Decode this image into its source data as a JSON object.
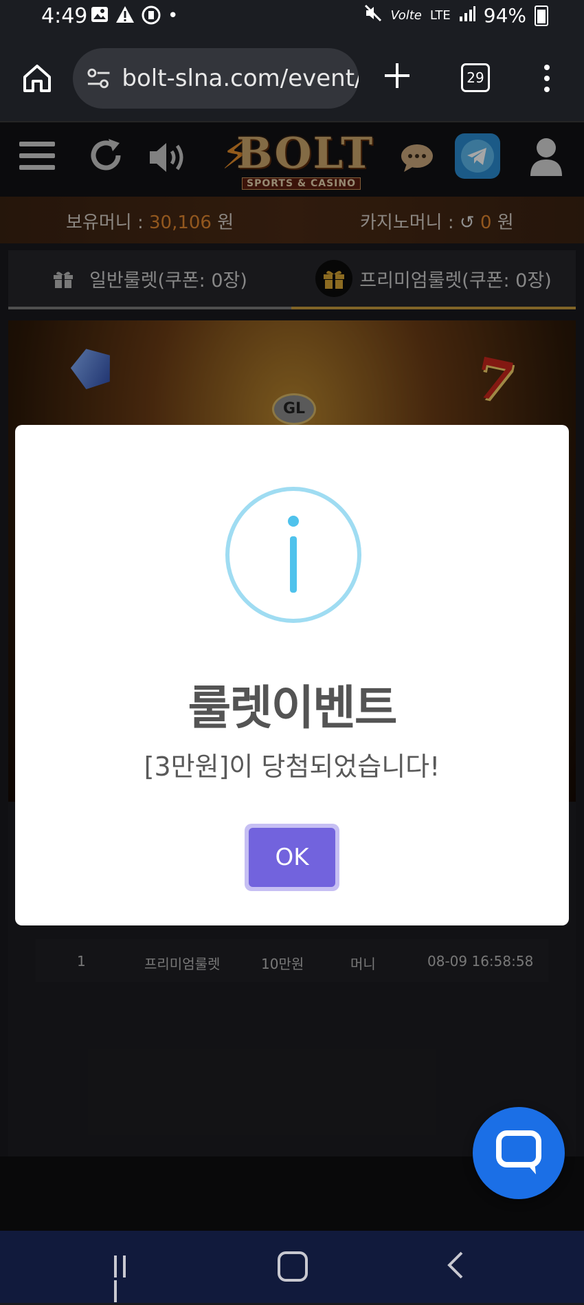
{
  "status_bar": {
    "time": "4:49",
    "lte": "LTE",
    "battery": "94%"
  },
  "browser": {
    "url": "bolt-slna.com/event/",
    "tab_count": "29"
  },
  "site": {
    "logo_text": "BOLT",
    "logo_sub": "SPORTS & CASINO"
  },
  "money": {
    "holding_label": "보유머니 : ",
    "holding_value": "30,106",
    "holding_unit": " 원",
    "casino_label": "카지노머니 : ",
    "casino_value": "0",
    "casino_unit": " 원"
  },
  "tabs": {
    "normal": "일반룰렛(쿠폰: 0장)",
    "premium": "프리미엄룰렛(쿠폰: 0장)"
  },
  "roulette": {
    "badge": "GL"
  },
  "win_table": {
    "rows": [
      {
        "no": "1",
        "type": "프리미엄룰렛",
        "amount": "10만원",
        "kind": "머니",
        "time": "08-09 16:58:58"
      }
    ]
  },
  "modal": {
    "title": "룰렛이벤트",
    "message": "[3만원]이 당첨되었습니다!",
    "ok_label": "OK",
    "icon": "info-icon"
  },
  "colors": {
    "accent_orange": "#e0862f",
    "ok_button": "#7263dd",
    "info_ring": "#9fdcf2",
    "chat_fab": "#1b6fe6"
  }
}
